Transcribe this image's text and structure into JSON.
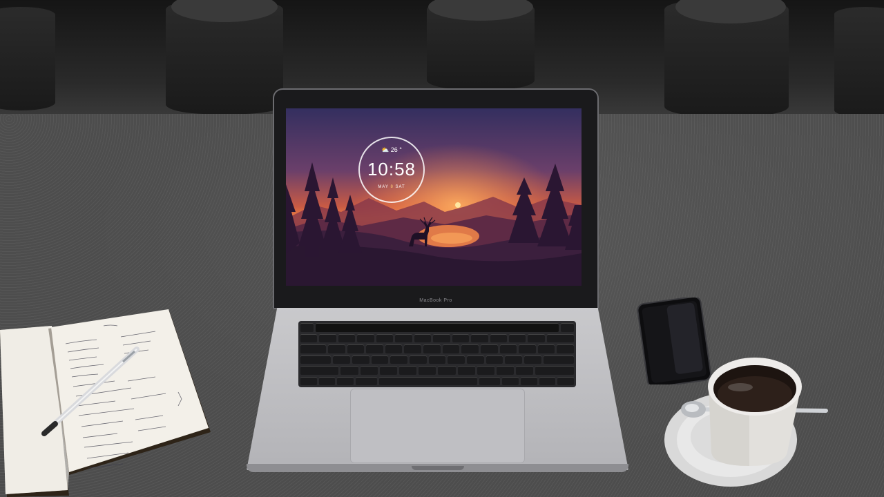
{
  "scene": {
    "description_type": "photo",
    "colors": {
      "desk": "#4d4d4d",
      "laptop_silver": "#c4c4c8",
      "screen_sky_top": "#3a2f5e",
      "screen_sky_mid": "#e0693a",
      "screen_sun": "#ffd27a"
    }
  },
  "laptop": {
    "brand_label": "MacBook Pro"
  },
  "clock_widget": {
    "temperature": "26 °",
    "time": "10:58",
    "date_prefix": "MAY",
    "date_day": "8",
    "date_suffix": "SAT"
  },
  "icons": {
    "weather": "partly-cloudy-icon",
    "deer": "deer-silhouette-icon"
  }
}
